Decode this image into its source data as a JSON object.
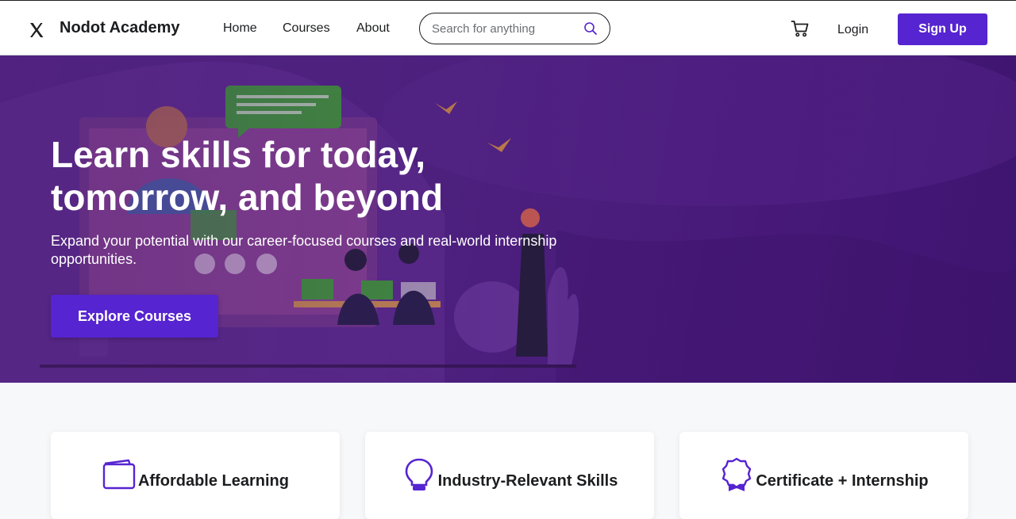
{
  "header": {
    "brand": "Nodot Academy",
    "nav": [
      "Home",
      "Courses",
      "About"
    ],
    "search_placeholder": "Search for anything",
    "login": "Login",
    "signup": "Sign Up"
  },
  "hero": {
    "title_line1": "Learn skills for today,",
    "title_line2": "tomorrow, and beyond",
    "subtitle": "Expand your potential with our career-focused courses and real-world internship opportunities.",
    "cta": "Explore Courses"
  },
  "features": [
    {
      "title": "Affordable Learning",
      "icon": "wallet-icon"
    },
    {
      "title": "Industry-Relevant Skills",
      "icon": "lightbulb-icon"
    },
    {
      "title": "Certificate + Internship",
      "icon": "award-icon"
    }
  ],
  "colors": {
    "accent": "#5624d0",
    "hero_bg": "#4f2284",
    "text": "#1c1d1f"
  }
}
